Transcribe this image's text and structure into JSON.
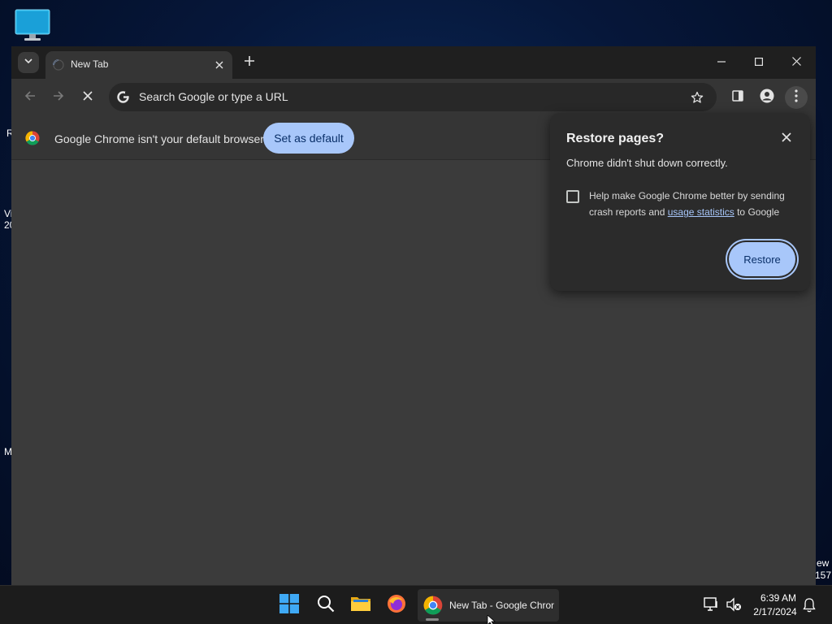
{
  "desktop": {
    "fragments": [
      "R",
      "Vi",
      "20",
      "M",
      "ew",
      "157"
    ]
  },
  "tab": {
    "title": "New Tab"
  },
  "omnibox": {
    "placeholder": "Search Google or type a URL"
  },
  "infobar": {
    "message": "Google Chrome isn't your default browser",
    "button": "Set as default"
  },
  "dialog": {
    "title": "Restore pages?",
    "message": "Chrome didn't shut down correctly.",
    "consent_pre": "Help make Google Chrome better by sending crash reports and ",
    "consent_link": "usage statistics",
    "consent_post": " to Google",
    "consent_checked": false,
    "button": "Restore"
  },
  "taskbar": {
    "chrome_label": "New Tab - Google Chrome",
    "time": "6:39 AM",
    "date": "2/17/2024"
  },
  "colors": {
    "accent": "#a8c7fa",
    "accent_text": "#0a3069",
    "window_bg": "#3b3b3b",
    "toolbar_bg": "#353535",
    "tabstrip_bg": "#1f1f1f"
  }
}
